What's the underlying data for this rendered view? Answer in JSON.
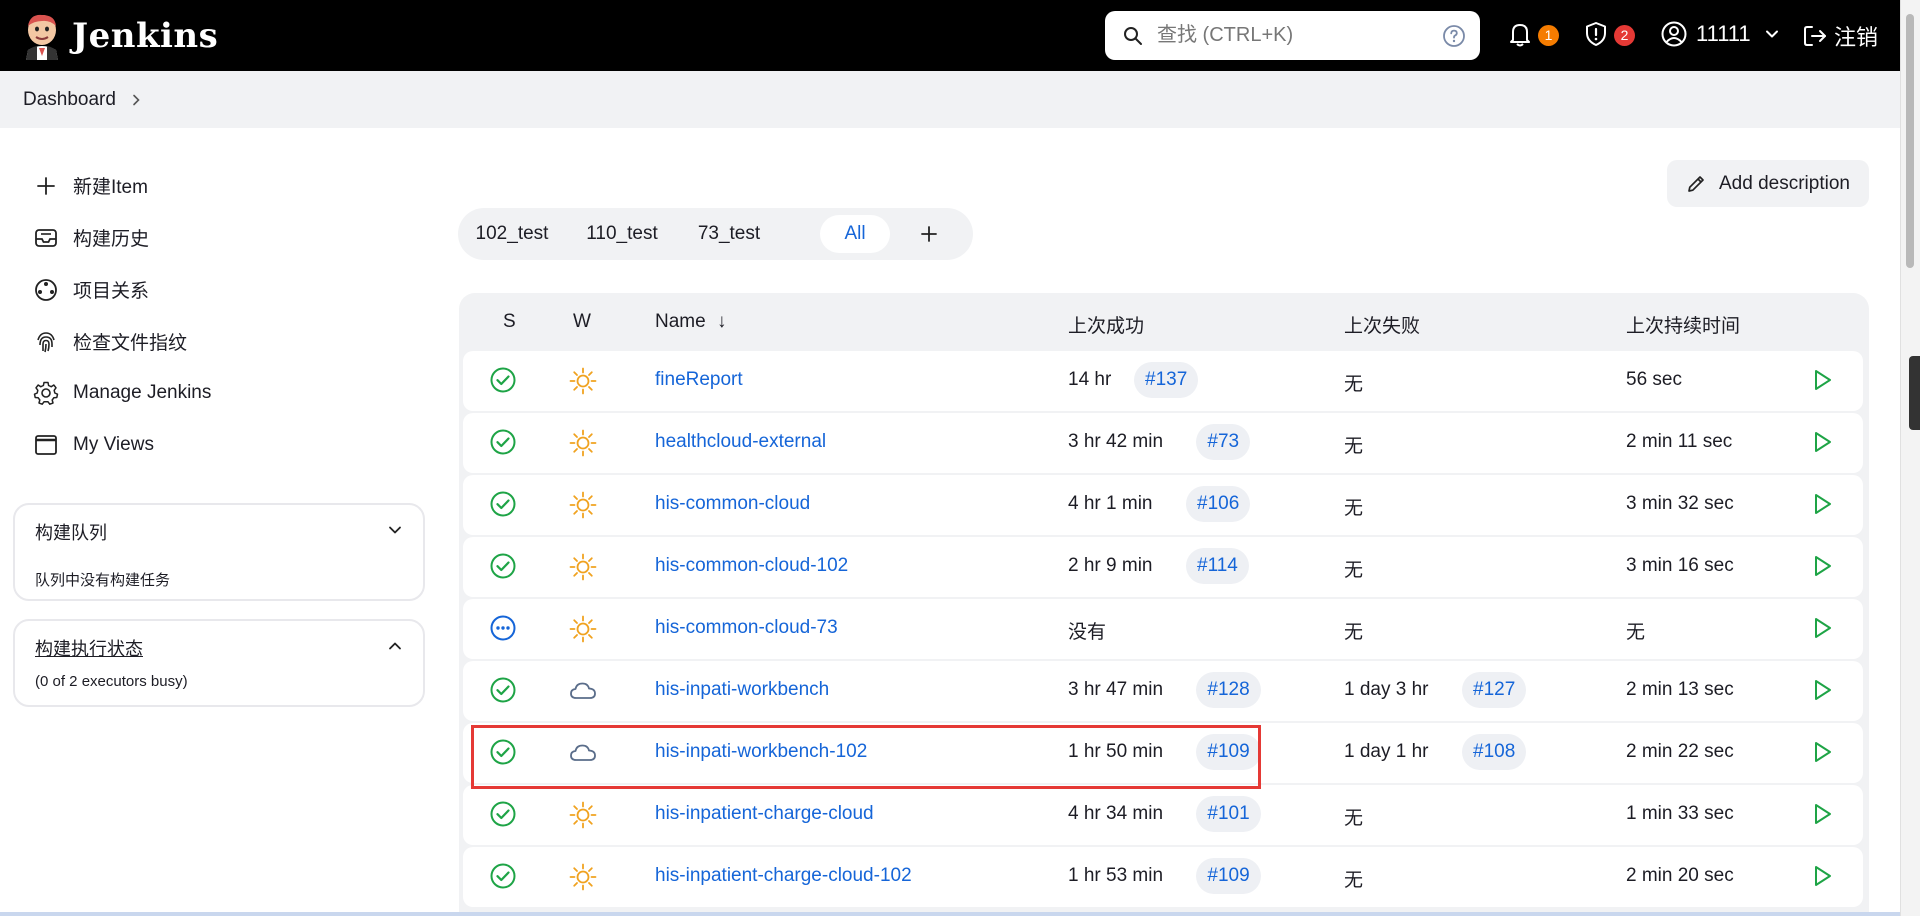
{
  "header": {
    "app_name": "Jenkins",
    "search_placeholder": "查找 (CTRL+K)",
    "notifications_count": "1",
    "security_count": "2",
    "user_name": "11111",
    "logout_label": "注销",
    "colors": {
      "notif_badge": "#f57c00",
      "security_badge": "#e53935"
    }
  },
  "breadcrumb": {
    "items": [
      "Dashboard"
    ]
  },
  "sidebar": {
    "items": [
      {
        "label": "新建Item",
        "icon": "plus-icon"
      },
      {
        "label": "构建历史",
        "icon": "history-inbox-icon"
      },
      {
        "label": "项目关系",
        "icon": "relationship-icon"
      },
      {
        "label": "检查文件指纹",
        "icon": "fingerprint-icon"
      },
      {
        "label": "Manage Jenkins",
        "icon": "gear-icon"
      },
      {
        "label": "My Views",
        "icon": "window-icon"
      }
    ],
    "build_queue": {
      "title": "构建队列",
      "message": "队列中没有构建任务"
    },
    "executor_status": {
      "title": "构建执行状态",
      "message": "(0 of 2 executors busy)"
    }
  },
  "actions": {
    "add_description": "Add description"
  },
  "views": {
    "tabs": [
      "102_test",
      "110_test",
      "73_test",
      "All"
    ],
    "active": "All"
  },
  "table": {
    "headers": {
      "status": "S",
      "weather": "W",
      "name": "Name",
      "sort_arrow": "↓",
      "last_success": "上次成功",
      "last_failure": "上次失败",
      "last_duration": "上次持续时间"
    },
    "rows": [
      {
        "status": "success",
        "weather": "sunny",
        "name": "fineReport",
        "last_success": "14 hr",
        "last_success_build": "#137",
        "last_failure": "无",
        "last_failure_build": "",
        "duration": "56 sec"
      },
      {
        "status": "success",
        "weather": "sunny",
        "name": "healthcloud-external",
        "last_success": "3 hr 42 min",
        "last_success_build": "#73",
        "last_failure": "无",
        "last_failure_build": "",
        "duration": "2 min 11 sec"
      },
      {
        "status": "success",
        "weather": "sunny",
        "name": "his-common-cloud",
        "last_success": "4 hr 1 min",
        "last_success_build": "#106",
        "last_failure": "无",
        "last_failure_build": "",
        "duration": "3 min 32 sec"
      },
      {
        "status": "success",
        "weather": "sunny",
        "name": "his-common-cloud-102",
        "last_success": "2 hr 9 min",
        "last_success_build": "#114",
        "last_failure": "无",
        "last_failure_build": "",
        "duration": "3 min 16 sec"
      },
      {
        "status": "notbuilt",
        "weather": "sunny",
        "name": "his-common-cloud-73",
        "last_success": "没有",
        "last_success_build": "",
        "last_failure": "无",
        "last_failure_build": "",
        "duration": "无"
      },
      {
        "status": "success",
        "weather": "cloudy",
        "name": "his-inpati-workbench",
        "last_success": "3 hr 47 min",
        "last_success_build": "#128",
        "last_failure": "1 day 3 hr",
        "last_failure_build": "#127",
        "duration": "2 min 13 sec"
      },
      {
        "status": "success",
        "weather": "cloudy",
        "name": "his-inpati-workbench-102",
        "last_success": "1 hr 50 min",
        "last_success_build": "#109",
        "last_failure": "1 day 1 hr",
        "last_failure_build": "#108",
        "duration": "2 min 22 sec"
      },
      {
        "status": "success",
        "weather": "sunny",
        "name": "his-inpatient-charge-cloud",
        "last_success": "4 hr 34 min",
        "last_success_build": "#101",
        "last_failure": "无",
        "last_failure_build": "",
        "duration": "1 min 33 sec"
      },
      {
        "status": "success",
        "weather": "sunny",
        "name": "his-inpatient-charge-cloud-102",
        "last_success": "1 hr 53 min",
        "last_success_build": "#109",
        "last_failure": "无",
        "last_failure_build": "",
        "duration": "2 min 20 sec"
      }
    ]
  },
  "colors": {
    "link": "#1565d8",
    "success": "#1ea446",
    "sun": "#f0a21f",
    "cloud": "#5a6d8a",
    "notbuilt": "#1565d8",
    "highlight": "#e53935"
  }
}
